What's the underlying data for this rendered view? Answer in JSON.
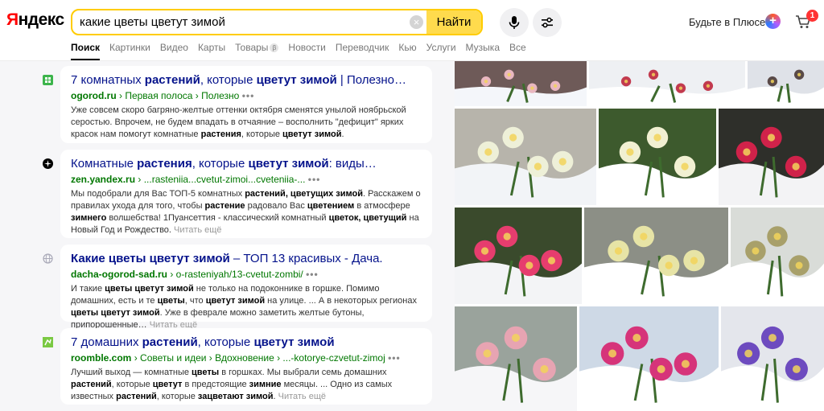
{
  "header": {
    "logo": "Яндекс",
    "search_value": "какие цветы цветут зимой",
    "clear_label": "×",
    "find_label": "Найти",
    "plus_label": "Будьте в Плюсе",
    "cart_count": "1"
  },
  "tabs": [
    {
      "label": "Поиск",
      "active": true
    },
    {
      "label": "Картинки"
    },
    {
      "label": "Видео"
    },
    {
      "label": "Карты"
    },
    {
      "label": "Товары",
      "badge": "β"
    },
    {
      "label": "Новости"
    },
    {
      "label": "Переводчик"
    },
    {
      "label": "Кью"
    },
    {
      "label": "Услуги"
    },
    {
      "label": "Музыка"
    },
    {
      "label": "Все"
    }
  ],
  "results": [
    {
      "title": [
        [
          "7 комнатных ",
          false
        ],
        [
          "растений",
          true
        ],
        [
          ", которые ",
          false
        ],
        [
          "цветут зимой",
          true
        ],
        [
          " | Полезно…",
          false
        ]
      ],
      "domain": "ogorod.ru",
      "path": " › Первая полоса › Полезно ",
      "dots": "•••",
      "snippet": [
        [
          "Уже совсем скоро багряно-желтые оттенки октября сменятся унылой ноябрьской серостью. Впрочем, не будем впадать в отчаяние – восполнить \"дефицит\" ярких красок нам помогут комнатные ",
          false
        ],
        [
          "растения",
          true
        ],
        [
          ", которые ",
          false
        ],
        [
          "цветут зимой",
          true
        ],
        [
          ".",
          false
        ]
      ],
      "more": ""
    },
    {
      "title": [
        [
          "Комнатные ",
          false
        ],
        [
          "растения",
          true
        ],
        [
          ", которые ",
          false
        ],
        [
          "цветут зимой",
          true
        ],
        [
          ": виды…",
          false
        ]
      ],
      "domain": "zen.yandex.ru",
      "path": " › ...rasteniia...cvetut-zimoi...cveteniia-... ",
      "dots": "•••",
      "snippet": [
        [
          "Мы подобрали для Вас ТОП-5 комнатных ",
          false
        ],
        [
          "растений, цветущих зимой",
          true
        ],
        [
          ". Расскажем о правилах ухода для того, чтобы ",
          false
        ],
        [
          "растение",
          true
        ],
        [
          " радовало Вас ",
          false
        ],
        [
          "цветением",
          true
        ],
        [
          " в атмосфере ",
          false
        ],
        [
          "зимнего",
          true
        ],
        [
          " волшебства! 1Пуансеттия - классический комнатный ",
          false
        ],
        [
          "цветок, цветущий",
          true
        ],
        [
          " на Новый Год и Рождество.",
          false
        ]
      ],
      "more": "Читать ещё"
    },
    {
      "title": [
        [
          "Какие цветы цветут зимой",
          true
        ],
        [
          " – ТОП 13 красивых - Дача.",
          false
        ]
      ],
      "domain": "dacha-ogorod-sad.ru",
      "path": " › o-rasteniyah/13-cvetut-zombi/ ",
      "dots": "•••",
      "snippet": [
        [
          "И такие ",
          false
        ],
        [
          "цветы цветут зимой",
          true
        ],
        [
          " не только на подоконнике в горшке. Помимо домашних, есть и те ",
          false
        ],
        [
          "цветы",
          true
        ],
        [
          ", что ",
          false
        ],
        [
          "цветут зимой",
          true
        ],
        [
          " на улице. ... А в некоторых регионах ",
          false
        ],
        [
          "цветы цветут зимой",
          true
        ],
        [
          ". Уже в феврале можно заметить желтые бутоны, припорошенные…",
          false
        ]
      ],
      "more": "Читать ещё"
    },
    {
      "title": [
        [
          "7 домашних ",
          false
        ],
        [
          "растений",
          true
        ],
        [
          ", которые ",
          false
        ],
        [
          "цветут зимой",
          true
        ]
      ],
      "domain": "roomble.com",
      "path": " › Советы и идеи › Вдохновение › ...-kotorye-czvetut-zimoj ",
      "dots": "•••",
      "snippet": [
        [
          "Лучший выход — комнатные ",
          false
        ],
        [
          "цветы",
          true
        ],
        [
          " в горшках. Мы выбрали семь домашних ",
          false
        ],
        [
          "растений",
          true
        ],
        [
          ", которые ",
          false
        ],
        [
          "цветут",
          true
        ],
        [
          " в предстоящие ",
          false
        ],
        [
          "зимние",
          true
        ],
        [
          " месяцы. ... Одно из самых известных ",
          false
        ],
        [
          "растений",
          true
        ],
        [
          ", которые ",
          false
        ],
        [
          "зацветают зимой",
          true
        ],
        [
          ".",
          false
        ]
      ],
      "more": "Читать ещё"
    }
  ],
  "images": [
    {
      "name": "pink-hellebore-photo",
      "bg": "#6e5a58",
      "flower": "#e9b7c0",
      "snow": "#f4f6fa"
    },
    {
      "name": "red-flowers-snow-photo",
      "bg": "#eef0f3",
      "flower": "#c23a4e",
      "snow": "#ffffff"
    },
    {
      "name": "dark-flower-snow-photo",
      "bg": "#dfe2e8",
      "flower": "#5a4a48",
      "snow": "#ffffff"
    },
    {
      "name": "white-hellebore-forest-photo",
      "bg": "#b7b4ab",
      "flower": "#eef0d8",
      "snow": "#f2f4f7"
    },
    {
      "name": "white-hellebore-closeup-photo",
      "bg": "#3d5a2d",
      "flower": "#f1f0d2",
      "snow": "#ffffff"
    },
    {
      "name": "red-cyclamen-snow-photo",
      "bg": "#2e2f2a",
      "flower": "#d0224a",
      "snow": "#f3f3f5"
    },
    {
      "name": "pink-camellia-snow-photo",
      "bg": "#3a4a2c",
      "flower": "#e63d6e",
      "snow": "#f3f4f6"
    },
    {
      "name": "yellow-hellebore-snow-photo",
      "bg": "#8c8f86",
      "flower": "#e7e4a6",
      "snow": "#ffffff"
    },
    {
      "name": "green-hellebore-snow-photo",
      "bg": "#d9dcd8",
      "flower": "#a8a06a",
      "snow": "#ffffff"
    },
    {
      "name": "pink-rose-snow-photo",
      "bg": "#9aa39c",
      "flower": "#e7a4b2",
      "snow": "#f6f6f8"
    },
    {
      "name": "pink-primula-snow-photo",
      "bg": "#ced9e6",
      "flower": "#d6347a",
      "snow": "#ffffff"
    },
    {
      "name": "violet-pansy-snow-photo",
      "bg": "#e4e6ec",
      "flower": "#6d4bbf",
      "snow": "#ffffff"
    }
  ]
}
